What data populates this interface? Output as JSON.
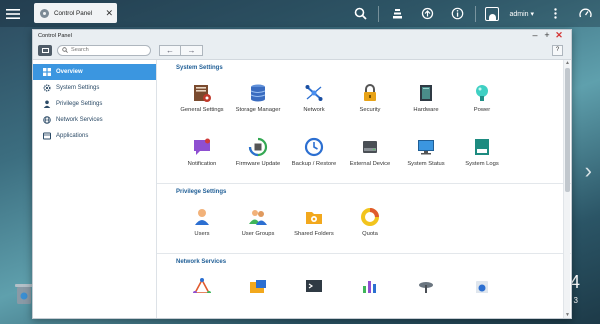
{
  "taskbar": {
    "tab_label": "Control Panel",
    "user_label": "admin ▾"
  },
  "desktop": {
    "clock_text": "4",
    "date_text": "3"
  },
  "window": {
    "title": "Control Panel",
    "search_placeholder": "Search",
    "help_label": "?",
    "back_label": "←",
    "forward_label": "→"
  },
  "sidebar": {
    "items": [
      {
        "label": "Overview",
        "icon": "grid-icon",
        "active": true
      },
      {
        "label": "System Settings",
        "icon": "gear-icon"
      },
      {
        "label": "Privilege Settings",
        "icon": "person-icon"
      },
      {
        "label": "Network Services",
        "icon": "globe-icon"
      },
      {
        "label": "Applications",
        "icon": "apps-icon"
      }
    ]
  },
  "sections": {
    "system": {
      "title": "System Settings",
      "apps": [
        {
          "label": "General Settings",
          "icon": "general-settings-icon"
        },
        {
          "label": "Storage Manager",
          "icon": "storage-manager-icon"
        },
        {
          "label": "Network",
          "icon": "network-icon"
        },
        {
          "label": "Security",
          "icon": "security-lock-icon"
        },
        {
          "label": "Hardware",
          "icon": "hardware-icon"
        },
        {
          "label": "Power",
          "icon": "power-bulb-icon"
        },
        {
          "label": "Notification",
          "icon": "notification-icon"
        },
        {
          "label": "Firmware Update",
          "icon": "firmware-update-icon"
        },
        {
          "label": "Backup / Restore",
          "icon": "backup-restore-icon"
        },
        {
          "label": "External Device",
          "icon": "external-device-icon"
        },
        {
          "label": "System Status",
          "icon": "system-status-icon"
        },
        {
          "label": "System Logs",
          "icon": "system-logs-icon"
        }
      ]
    },
    "privilege": {
      "title": "Privilege Settings",
      "apps": [
        {
          "label": "Users",
          "icon": "users-icon"
        },
        {
          "label": "User Groups",
          "icon": "user-groups-icon"
        },
        {
          "label": "Shared Folders",
          "icon": "shared-folders-icon"
        },
        {
          "label": "Quota",
          "icon": "quota-icon"
        }
      ]
    },
    "network": {
      "title": "Network Services"
    }
  },
  "colors": {
    "accent": "#3b96e0",
    "section_title": "#1f5e96",
    "close": "#d43434"
  }
}
